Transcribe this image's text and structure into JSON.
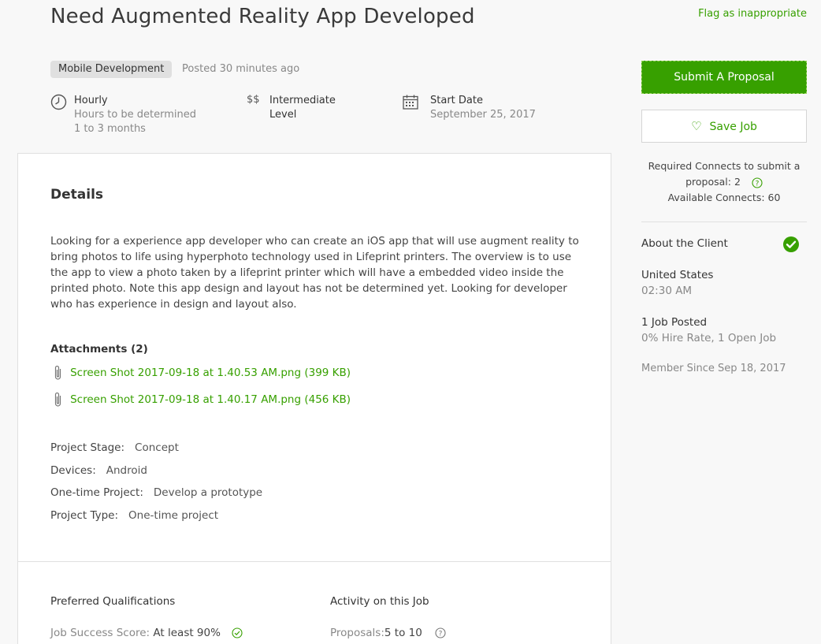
{
  "job": {
    "title": "Need Augmented Reality App Developed",
    "flag_label": "Flag as inappropriate",
    "category": "Mobile Development",
    "posted": "Posted 30 minutes ago"
  },
  "meta": {
    "hourly": {
      "icon": "clock-icon",
      "title": "Hourly",
      "line1": "Hours to be determined",
      "line2": "1 to 3 months"
    },
    "level": {
      "icon": "dollar-icon",
      "symbol": "$$",
      "title_line1": "Intermediate",
      "title_line2": "Level"
    },
    "start": {
      "icon": "calendar-icon",
      "title": "Start Date",
      "date": "September 25, 2017"
    }
  },
  "details": {
    "heading": "Details",
    "description": "Looking for a experience app developer who can create an iOS app that will use augment reality to bring photos to life using hyperphoto technology used in Lifeprint printers. The overview is to use the app to view a photo taken by a lifeprint printer which will have a embedded video inside the printed photo. Note this app design and layout has not be determined yet. Looking for developer who has experience in design and layout also.",
    "attachments_heading": "Attachments (2)",
    "attachments": [
      {
        "icon": "paperclip-icon",
        "label": "Screen Shot 2017-09-18 at 1.40.53 AM.png (399 KB)"
      },
      {
        "icon": "paperclip-icon",
        "label": "Screen Shot 2017-09-18 at 1.40.17 AM.png (456 KB)"
      }
    ],
    "properties": [
      {
        "key": "Project Stage:",
        "value": "Concept"
      },
      {
        "key": "Devices:",
        "value": "Android"
      },
      {
        "key": "One-time Project:",
        "value": "Develop a prototype"
      },
      {
        "key": "Project Type:",
        "value": "One-time project"
      }
    ]
  },
  "qualifications": {
    "heading": "Preferred Qualifications",
    "job_success_key": "Job Success Score:",
    "job_success_value": "At least 90%"
  },
  "activity": {
    "heading": "Activity on this Job",
    "proposals_key": "Proposals:",
    "proposals_value": "5 to 10"
  },
  "sidebar": {
    "submit_label": "Submit A Proposal",
    "save_label": "Save Job",
    "connects_line1": "Required Connects to submit a",
    "connects_line2": "proposal: 2",
    "connects_line3": "Available Connects: 60",
    "about_heading": "About the Client",
    "country": "United States",
    "local_time": "02:30 AM",
    "jobs_posted": "1 Job Posted",
    "hire_rate": "0% Hire Rate, 1 Open Job",
    "member_since": "Member Since Sep 18, 2017"
  },
  "colors": {
    "accent": "#37a000",
    "background": "#f8f8f8",
    "card": "#ffffff",
    "muted_text": "#888888"
  }
}
